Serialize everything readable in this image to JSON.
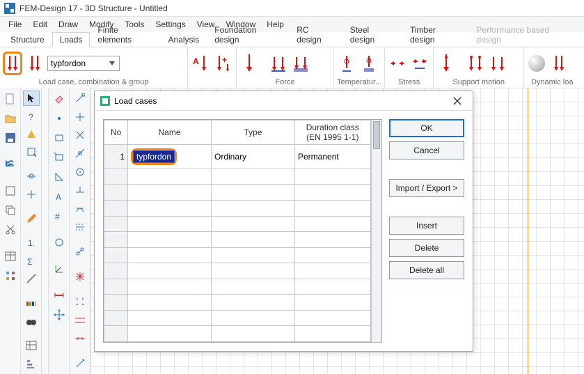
{
  "title": "FEM-Design 17 - 3D Structure - Untitled",
  "menu": [
    "File",
    "Edit",
    "Draw",
    "Modify",
    "Tools",
    "Settings",
    "View",
    "Window",
    "Help"
  ],
  "tabs": [
    {
      "label": "Structure",
      "active": false,
      "disabled": false
    },
    {
      "label": "Loads",
      "active": true,
      "disabled": false
    },
    {
      "label": "Finite elements",
      "active": false,
      "disabled": false
    },
    {
      "label": "Analysis",
      "active": false,
      "disabled": false
    },
    {
      "label": "Foundation design",
      "active": false,
      "disabled": false
    },
    {
      "label": "RC design",
      "active": false,
      "disabled": false
    },
    {
      "label": "Steel design",
      "active": false,
      "disabled": false
    },
    {
      "label": "Timber design",
      "active": false,
      "disabled": false
    },
    {
      "label": "Performance based design",
      "active": false,
      "disabled": true
    }
  ],
  "ribbon": {
    "loadcase_dropdown": "typfordon",
    "groups": [
      "Load case, combination & group",
      "",
      "Force",
      "Temperatur...",
      "Stress",
      "Support motion",
      "Dynamic loa"
    ]
  },
  "dialog": {
    "title": "Load cases",
    "columns": {
      "no": "No",
      "name": "Name",
      "type": "Type",
      "duration": "Duration class\n(EN 1995 1-1)"
    },
    "rows": [
      {
        "no": "1",
        "name": "typfordon",
        "type": "Ordinary",
        "duration": "Permanent"
      }
    ],
    "buttons": {
      "ok": "OK",
      "cancel": "Cancel",
      "importexport": "Import / Export >",
      "insert": "Insert",
      "delete": "Delete",
      "deleteall": "Delete all"
    }
  }
}
